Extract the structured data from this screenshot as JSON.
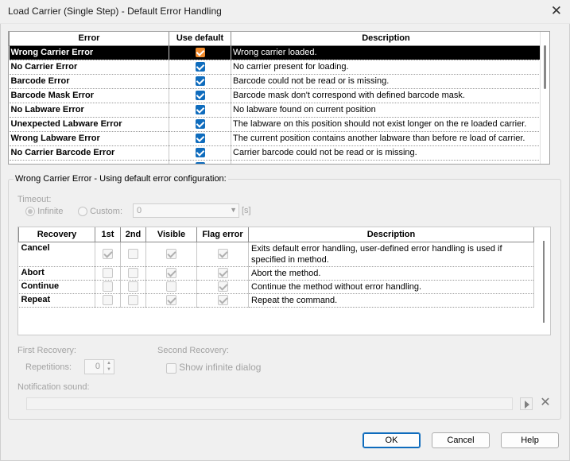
{
  "window": {
    "title": "Load Carrier (Single Step) - Default Error Handling",
    "close_glyph": "✕"
  },
  "errors_table": {
    "headers": {
      "error": "Error",
      "use_default": "Use default",
      "description": "Description"
    },
    "rows": [
      {
        "name": "Wrong Carrier Error",
        "use_default": true,
        "description": "Wrong carrier loaded.",
        "selected": true
      },
      {
        "name": "No Carrier Error",
        "use_default": true,
        "description": "No carrier present for loading."
      },
      {
        "name": "Barcode Error",
        "use_default": true,
        "description": "Barcode could not be read or is missing."
      },
      {
        "name": "Barcode Mask Error",
        "use_default": true,
        "description": "Barcode mask don't correspond with defined barcode mask."
      },
      {
        "name": "No Labware Error",
        "use_default": true,
        "description": "No labware found on current position"
      },
      {
        "name": "Unexpected Labware Error",
        "use_default": true,
        "description": "The labware on this position should not exist longer on the re loaded carrier."
      },
      {
        "name": "Wrong Labware Error",
        "use_default": true,
        "description": "The current position contains another labware than before re load of carrier."
      },
      {
        "name": "No Carrier Barcode Error",
        "use_default": true,
        "description": "Carrier barcode could not be read or is missing."
      }
    ]
  },
  "config": {
    "group_title": "Wrong Carrier Error - Using default error configuration:",
    "timeout_label": "Timeout:",
    "infinite_label": "Infinite",
    "custom_label": "Custom:",
    "custom_value": "0",
    "unit": "[s]"
  },
  "recovery_table": {
    "headers": {
      "recovery": "Recovery",
      "first": "1st",
      "second": "2nd",
      "visible": "Visible",
      "flag_error": "Flag error",
      "description": "Description"
    },
    "rows": [
      {
        "name": "Cancel",
        "first": true,
        "second": false,
        "visible": true,
        "flag_error": true,
        "description": "Exits default error handling, user-defined error handling is used if specified in method."
      },
      {
        "name": "Abort",
        "first": false,
        "second": false,
        "visible": true,
        "flag_error": true,
        "description": "Abort the method."
      },
      {
        "name": "Continue",
        "first": false,
        "second": false,
        "visible": false,
        "flag_error": true,
        "description": "Continue the method without error handling."
      },
      {
        "name": "Repeat",
        "first": false,
        "second": false,
        "visible": true,
        "flag_error": true,
        "description": "Repeat the command."
      }
    ]
  },
  "recovery_options": {
    "first_recovery_label": "First Recovery:",
    "second_recovery_label": "Second Recovery:",
    "repetitions_label": "Repetitions:",
    "repetitions_value": "0",
    "show_infinite_dialog_label": "Show infinite dialog",
    "notification_sound_label": "Notification sound:"
  },
  "buttons": {
    "ok": "OK",
    "cancel": "Cancel",
    "help": "Help"
  },
  "colors": {
    "accent": "#0f6cbd",
    "selected_checkbox": "#f08a2c"
  },
  "icons": {
    "play": "play-icon",
    "clear": "clear-icon",
    "close": "close-icon"
  }
}
